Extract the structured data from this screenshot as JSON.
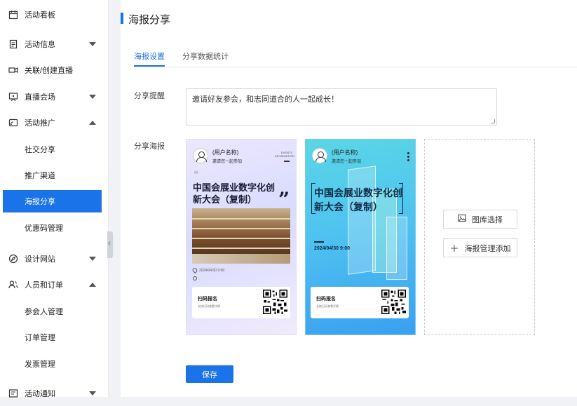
{
  "sidebar": {
    "items": [
      {
        "label": "活动看板",
        "icon": "calendar-icon"
      },
      {
        "label": "活动信息",
        "icon": "document-icon",
        "caret": "down"
      },
      {
        "label": "关联/创建直播",
        "icon": "video-camera-icon"
      },
      {
        "label": "直播会场",
        "icon": "presentation-icon",
        "caret": "down"
      },
      {
        "label": "活动推广",
        "icon": "broadcast-icon",
        "caret": "up"
      },
      {
        "label": "社交分享"
      },
      {
        "label": "推广渠道"
      },
      {
        "label": "海报分享",
        "active": true
      },
      {
        "label": "优惠码管理"
      },
      {
        "label": "设计网站",
        "icon": "compass-icon",
        "caret": "down"
      },
      {
        "label": "人员和订单",
        "icon": "users-icon",
        "caret": "up"
      },
      {
        "label": "参会人管理"
      },
      {
        "label": "订单管理"
      },
      {
        "label": "发票管理"
      },
      {
        "label": "活动通知",
        "icon": "notice-icon",
        "caret": "down"
      }
    ]
  },
  "main": {
    "title": "海报分享",
    "tabs": [
      {
        "label": "海报设置",
        "active": true
      },
      {
        "label": "分享数据统计",
        "active": false
      }
    ],
    "share_tip_label": "分享提醒",
    "share_tip_value": "邀请好友参会，和志同道合的人一起成长！",
    "share_poster_label": "分享海报",
    "posters": [
      {
        "user_name": "(用户名称)",
        "invite_text": "邀请您一起参加",
        "events_text_1": "EVENTS",
        "events_text_2": "INFORMATION",
        "event_title": "中国会展业数字化创新大会（复制）",
        "date": "2024/04/30 9:00",
        "scan_title": "扫码报名",
        "scan_sub": "长按扫码查看详情"
      },
      {
        "user_name": "(用户名称)",
        "invite_text": "邀请您一起参加",
        "event_title": "中国会展业数字化创新大会（复制）",
        "date": "2024/04/30 9:00",
        "scan_title": "扫码报名",
        "scan_sub": "长按扫码查看详情"
      }
    ],
    "gallery_button": "图库选择",
    "manage_button": "海报管理添加",
    "save_button": "保存"
  },
  "colors": {
    "accent": "#1a73e8"
  }
}
